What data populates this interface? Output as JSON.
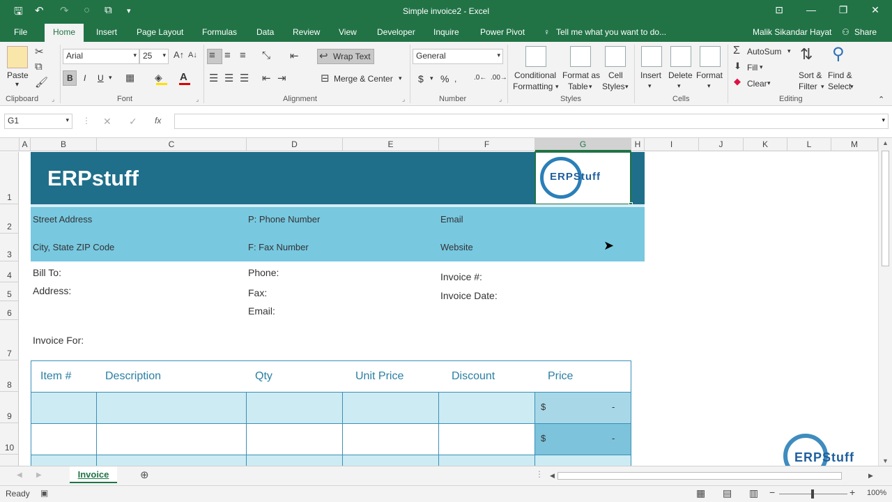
{
  "window": {
    "title": "Simple invoice2 - Excel",
    "user": "Malik Sikandar Hayat",
    "share_label": "Share",
    "accent": "#217346"
  },
  "tabs": [
    "File",
    "Home",
    "Insert",
    "Page Layout",
    "Formulas",
    "Data",
    "Review",
    "View",
    "Developer",
    "Inquire",
    "Power Pivot"
  ],
  "tell_me": "Tell me what you want to do...",
  "ribbon": {
    "clipboard": {
      "label": "Clipboard",
      "paste": "Paste"
    },
    "font": {
      "label": "Font",
      "name": "Arial",
      "size": "25",
      "bold": "B",
      "italic": "I",
      "underline": "U"
    },
    "alignment": {
      "label": "Alignment",
      "wrap": "Wrap Text",
      "merge": "Merge & Center"
    },
    "number": {
      "label": "Number",
      "format": "General",
      "currency": "$",
      "percent": "%"
    },
    "styles": {
      "label": "Styles",
      "conditional_1": "Conditional",
      "conditional_2": "Formatting",
      "format_table_1": "Format as",
      "format_table_2": "Table",
      "cell_styles_1": "Cell",
      "cell_styles_2": "Styles"
    },
    "cells": {
      "label": "Cells",
      "insert": "Insert",
      "delete": "Delete",
      "format": "Format"
    },
    "editing": {
      "label": "Editing",
      "autosum": "AutoSum",
      "fill": "Fill",
      "clear": "Clear",
      "sort_1": "Sort &",
      "sort_2": "Filter",
      "find_1": "Find &",
      "find_2": "Select"
    }
  },
  "formula_bar": {
    "name_box": "G1",
    "fx": "fx",
    "value": ""
  },
  "columns": [
    "A",
    "B",
    "C",
    "D",
    "E",
    "F",
    "G",
    "H",
    "I",
    "J",
    "K",
    "L",
    "M"
  ],
  "rows": [
    "1",
    "2",
    "3",
    "4",
    "5",
    "6",
    "7",
    "8",
    "9",
    "10"
  ],
  "invoice": {
    "company": "ERPstuff",
    "logo_text": "ERPStuff",
    "street": "Street Address",
    "city": "City, State ZIP Code",
    "phone_hdr": "P: Phone Number",
    "fax_hdr": "F: Fax Number",
    "email_hdr": "Email",
    "website_hdr": "Website",
    "bill_to": "Bill To:",
    "address": "Address:",
    "phone": "Phone:",
    "fax": "Fax:",
    "email": "Email:",
    "invoice_no": "Invoice #:",
    "invoice_date": "Invoice Date:",
    "invoice_for": "Invoice For:",
    "table_headers": [
      "Item #",
      "Description",
      "Qty",
      "Unit Price",
      "Discount",
      "Price"
    ],
    "price_rows": [
      {
        "currency": "$",
        "value": "-"
      },
      {
        "currency": "$",
        "value": "-"
      }
    ]
  },
  "sheet": {
    "active_tab": "Invoice"
  },
  "status": {
    "ready": "Ready",
    "zoom": "100%"
  }
}
